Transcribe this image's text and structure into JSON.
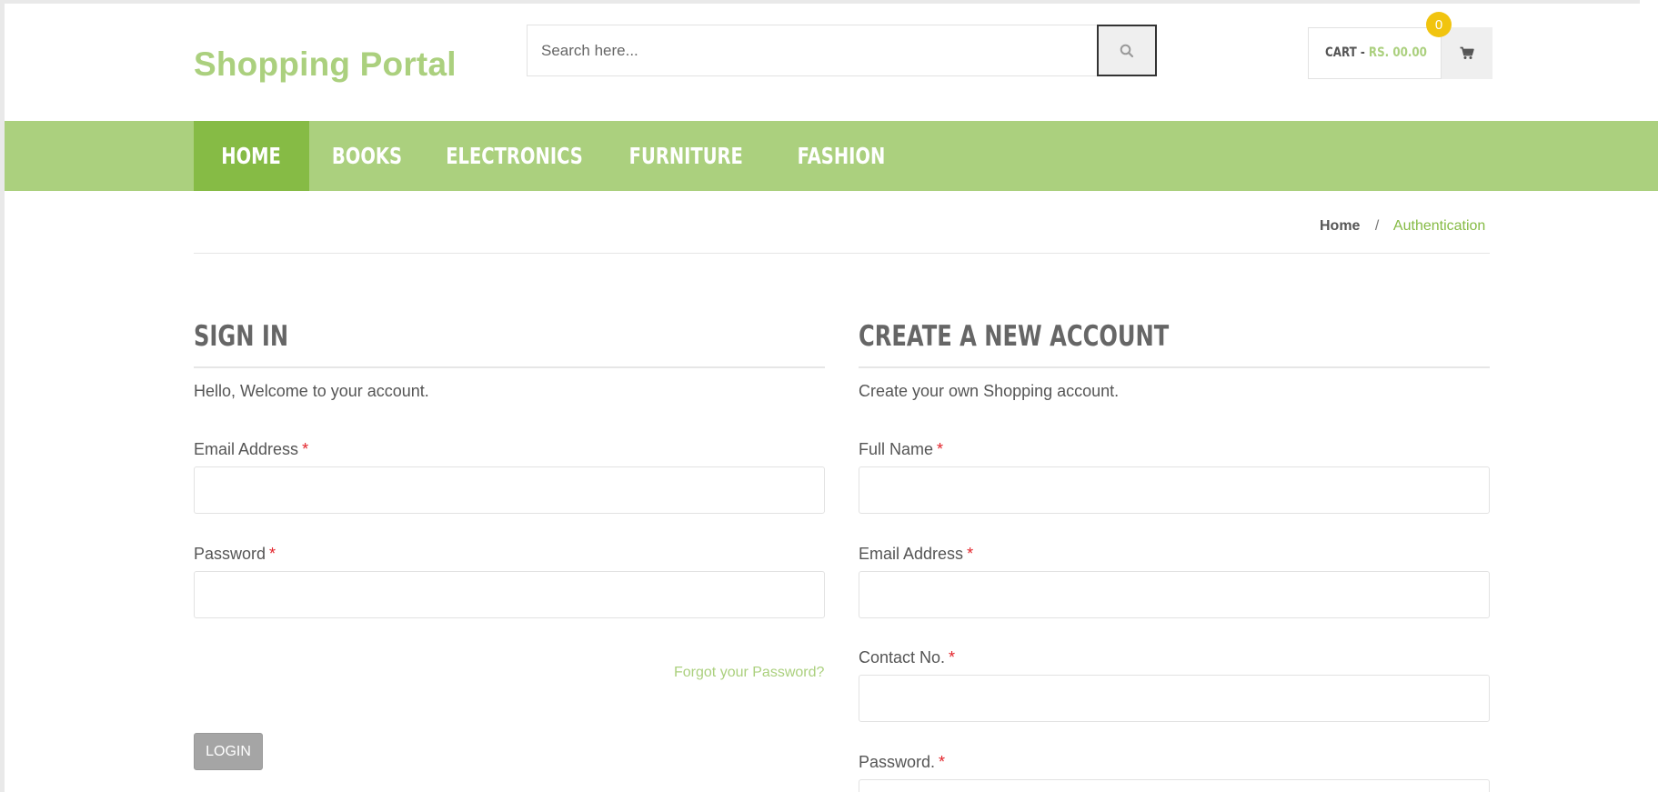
{
  "brand": {
    "title": "Shopping Portal"
  },
  "search": {
    "placeholder": "Search here...",
    "icon": "search-icon"
  },
  "cart": {
    "label": "CART -",
    "amount": "RS. 00.00",
    "count": "0",
    "icon": "shopping-cart-icon",
    "badge_color": "#f1c40f"
  },
  "nav": {
    "items": [
      {
        "label": "HOME",
        "active": true
      },
      {
        "label": "BOOKS",
        "active": false
      },
      {
        "label": "ELECTRONICS",
        "active": false
      },
      {
        "label": "FURNITURE",
        "active": false
      },
      {
        "label": "FASHION",
        "active": false
      }
    ]
  },
  "breadcrumb": {
    "home": "Home",
    "separator": "/",
    "current": "Authentication"
  },
  "signin": {
    "title": "SIGN IN",
    "subtitle": "Hello, Welcome to your account.",
    "email_label": "Email Address",
    "password_label": "Password",
    "required_mark": "*",
    "forgot_label": "Forgot your Password?",
    "login_label": "LOGIN"
  },
  "register": {
    "title": "CREATE A NEW ACCOUNT",
    "subtitle": "Create your own Shopping account.",
    "fullname_label": "Full Name",
    "email_label": "Email Address",
    "contact_label": "Contact No.",
    "password_label": "Password.",
    "required_mark": "*"
  },
  "colors": {
    "brand": "#abd07e",
    "nav_background": "#abd07e",
    "nav_active": "#86bb45",
    "required": "#e3242b",
    "button": "#a5a5a5"
  }
}
